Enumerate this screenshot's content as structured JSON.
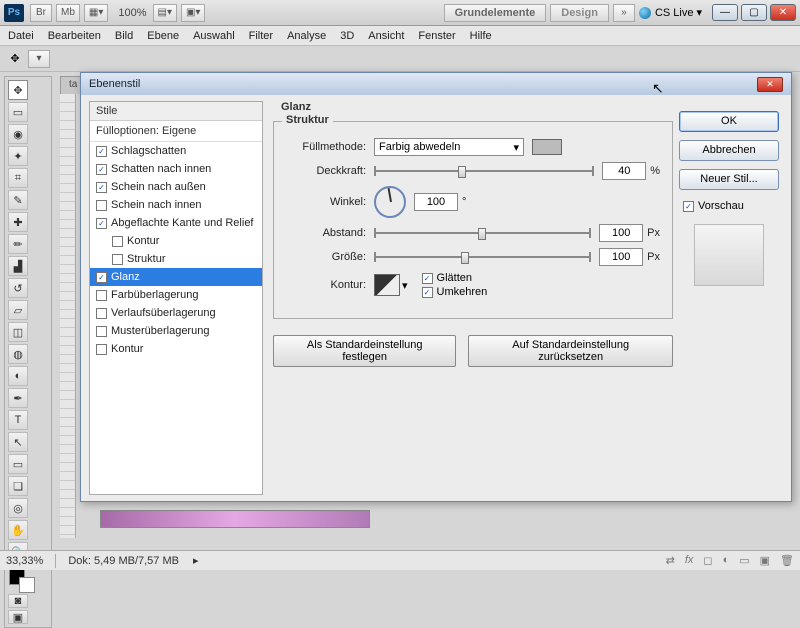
{
  "appbar": {
    "zoom": "100%",
    "label_essentials": "Grundelemente",
    "label_design": "Design",
    "cs_live": "CS Live"
  },
  "menus": [
    "Datei",
    "Bearbeiten",
    "Bild",
    "Ebene",
    "Auswahl",
    "Filter",
    "Analyse",
    "3D",
    "Ansicht",
    "Fenster",
    "Hilfe"
  ],
  "dialog": {
    "title": "Ebenenstil",
    "styles_header": "Stile",
    "fill_options": "Fülloptionen: Eigene",
    "items": [
      {
        "label": "Schlagschatten",
        "checked": true,
        "sel": false
      },
      {
        "label": "Schatten nach innen",
        "checked": true,
        "sel": false
      },
      {
        "label": "Schein nach außen",
        "checked": true,
        "sel": false
      },
      {
        "label": "Schein nach innen",
        "checked": false,
        "sel": false
      },
      {
        "label": "Abgeflachte Kante und Relief",
        "checked": true,
        "sel": false
      },
      {
        "label": "Kontur",
        "checked": false,
        "sel": false,
        "indent": true
      },
      {
        "label": "Struktur",
        "checked": false,
        "sel": false,
        "indent": true
      },
      {
        "label": "Glanz",
        "checked": true,
        "sel": true
      },
      {
        "label": "Farbüberlagerung",
        "checked": false,
        "sel": false
      },
      {
        "label": "Verlaufsüberlagerung",
        "checked": false,
        "sel": false
      },
      {
        "label": "Musterüberlagerung",
        "checked": false,
        "sel": false
      },
      {
        "label": "Kontur",
        "checked": false,
        "sel": false
      }
    ],
    "section": "Glanz",
    "group": "Struktur",
    "labels": {
      "blend": "Füllmethode:",
      "opacity": "Deckkraft:",
      "angle": "Winkel:",
      "distance": "Abstand:",
      "size": "Größe:",
      "contour": "Kontur:",
      "smooth": "Glätten",
      "invert": "Umkehren"
    },
    "blend_mode": "Farbig abwedeln",
    "opacity": "40",
    "opacity_unit": "%",
    "angle": "100",
    "angle_unit": "°",
    "distance": "100",
    "distance_unit": "Px",
    "size": "100",
    "size_unit": "Px",
    "smooth_checked": true,
    "invert_checked": true,
    "btn_default_set": "Als Standardeinstellung festlegen",
    "btn_default_reset": "Auf Standardeinstellung zurücksetzen",
    "ok": "OK",
    "cancel": "Abbrechen",
    "new_style": "Neuer Stil...",
    "preview": "Vorschau"
  },
  "status": {
    "zoom": "33,33%",
    "doc": "Dok: 5,49 MB/7,57 MB"
  }
}
